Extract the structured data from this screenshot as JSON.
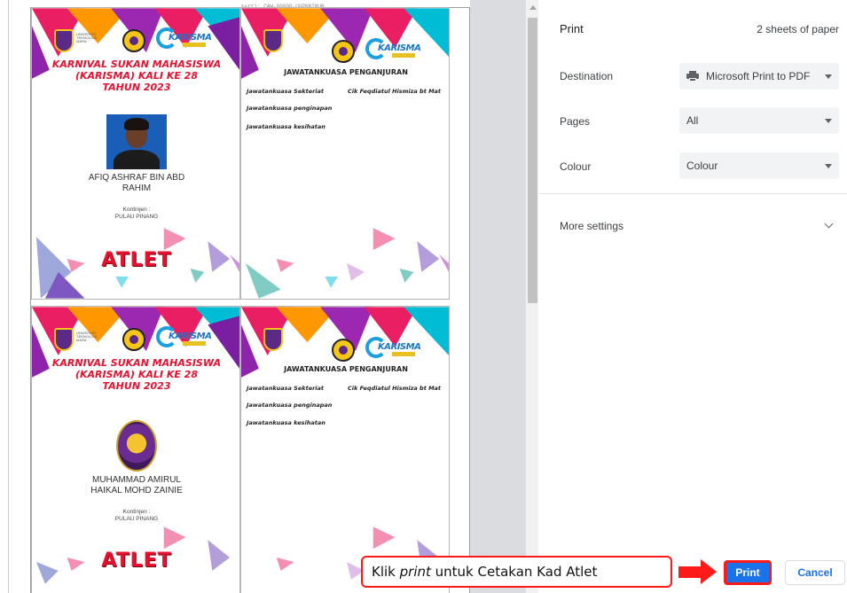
{
  "header": {
    "tiny_text": "kerti: CAW-00000-UUPNNINUN"
  },
  "cards": {
    "top_left": {
      "event_title_1": "KARNIVAL SUKAN MAHASISWA",
      "event_title_2": "(KARISMA) KALI KE 28",
      "event_title_3": "TAHUN 2023",
      "name_1": "AFIQ ASHRAF BIN ABD",
      "name_2": "RAHIM",
      "contingent_label": "Kontinjen :",
      "contingent_value": "PULAU PINANG",
      "role": "ATLET"
    },
    "bottom_left": {
      "event_title_1": "KARNIVAL SUKAN MAHASISWA",
      "event_title_2": "(KARISMA) KALI KE 28",
      "event_title_3": "TAHUN 2023",
      "name_1": "MUHAMMAD AMIRUL",
      "name_2": "HAIKAL MOHD ZAINIE",
      "contingent_label": "Kontinjen :",
      "contingent_value": "PULAU PINANG",
      "role": "ATLET"
    },
    "committee": {
      "title": "JAWATANKUASA PENGANJURAN",
      "line_1": "Jawatankuasa Sekteriat",
      "line_1_value": "Cik Feqdiatul Hismiza bt Mat",
      "line_2": "Jawatankuasa penginapan",
      "line_3": "Jawatankuasa kesihatan"
    },
    "logo_text": "KARISMA"
  },
  "panel": {
    "title": "Print",
    "sheets": "2 sheets of paper",
    "destination_label": "Destination",
    "destination_value": "Microsoft Print to PDF",
    "pages_label": "Pages",
    "pages_value": "All",
    "colour_label": "Colour",
    "colour_value": "Colour",
    "more_settings": "More settings",
    "print_button": "Print",
    "cancel_button": "Cancel"
  },
  "annotation": {
    "before": "Klik ",
    "emphasis": "print",
    "after": " untuk Cetakan Kad Atlet"
  },
  "colors": {
    "accent_blue": "#1a73e8",
    "annotation_red": "#ff1a1a",
    "title_red": "#e8102f"
  }
}
